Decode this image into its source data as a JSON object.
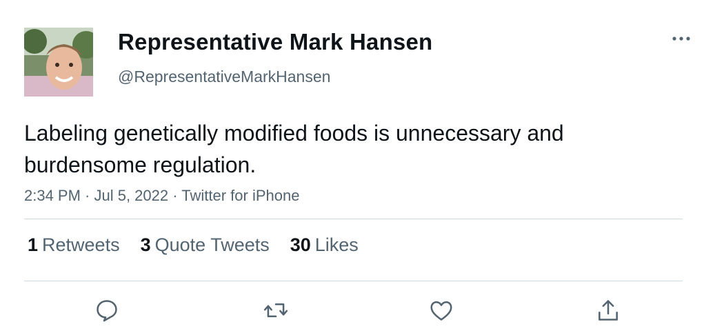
{
  "tweet": {
    "author": {
      "display_name": "Representative Mark Hansen",
      "handle": "@RepresentativeMarkHansen"
    },
    "text": "Labeling genetically modified foods is unnecessary and burdensome regulation.",
    "meta": "2:34 PM · Jul 5, 2022 · Twitter for iPhone",
    "stats": {
      "retweets": {
        "count": "1",
        "label": "Retweets"
      },
      "quote_tweets": {
        "count": "3",
        "label": "Quote Tweets"
      },
      "likes": {
        "count": "30",
        "label": "Likes"
      }
    },
    "actions": [
      "reply-icon",
      "retweet-icon",
      "like-icon",
      "share-icon"
    ],
    "colors": {
      "text": "#0f1419",
      "secondary": "#536471",
      "divider": "#cfd9de"
    }
  }
}
